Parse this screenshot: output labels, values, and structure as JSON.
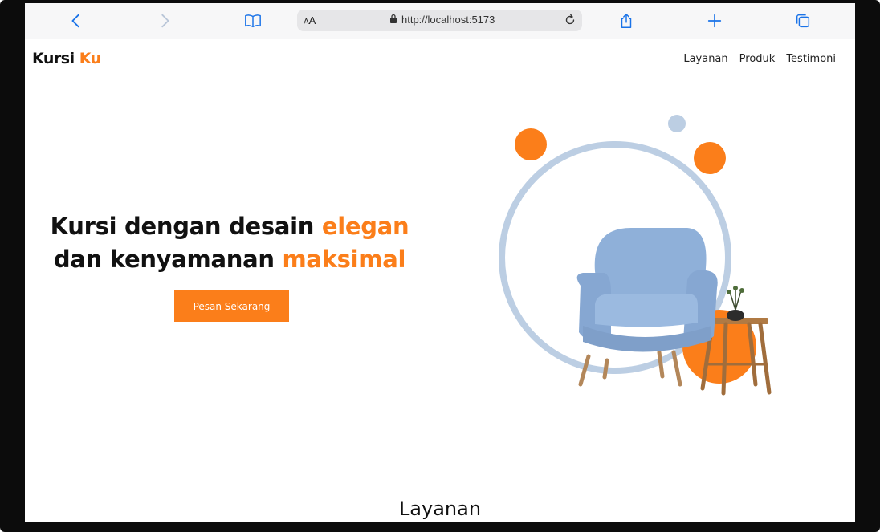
{
  "browser": {
    "text_size_small": "A",
    "text_size_large": "A",
    "url": "http://localhost:5173",
    "accent_color": "#1a73e8"
  },
  "site": {
    "logo_main": "Kursi ",
    "logo_accent": "Ku",
    "nav": [
      "Layanan",
      "Produk",
      "Testimoni"
    ],
    "hero": {
      "line1_plain": "Kursi dengan desain ",
      "line1_accent": "elegan",
      "line2_plain": "dan kenyamanan ",
      "line2_accent": "maksimal",
      "cta": "Pesan Sekarang"
    },
    "section_title": "Layanan",
    "colors": {
      "accent": "#fb7e1a",
      "chair": "#8fb0d9",
      "ring": "#bccee3"
    }
  }
}
